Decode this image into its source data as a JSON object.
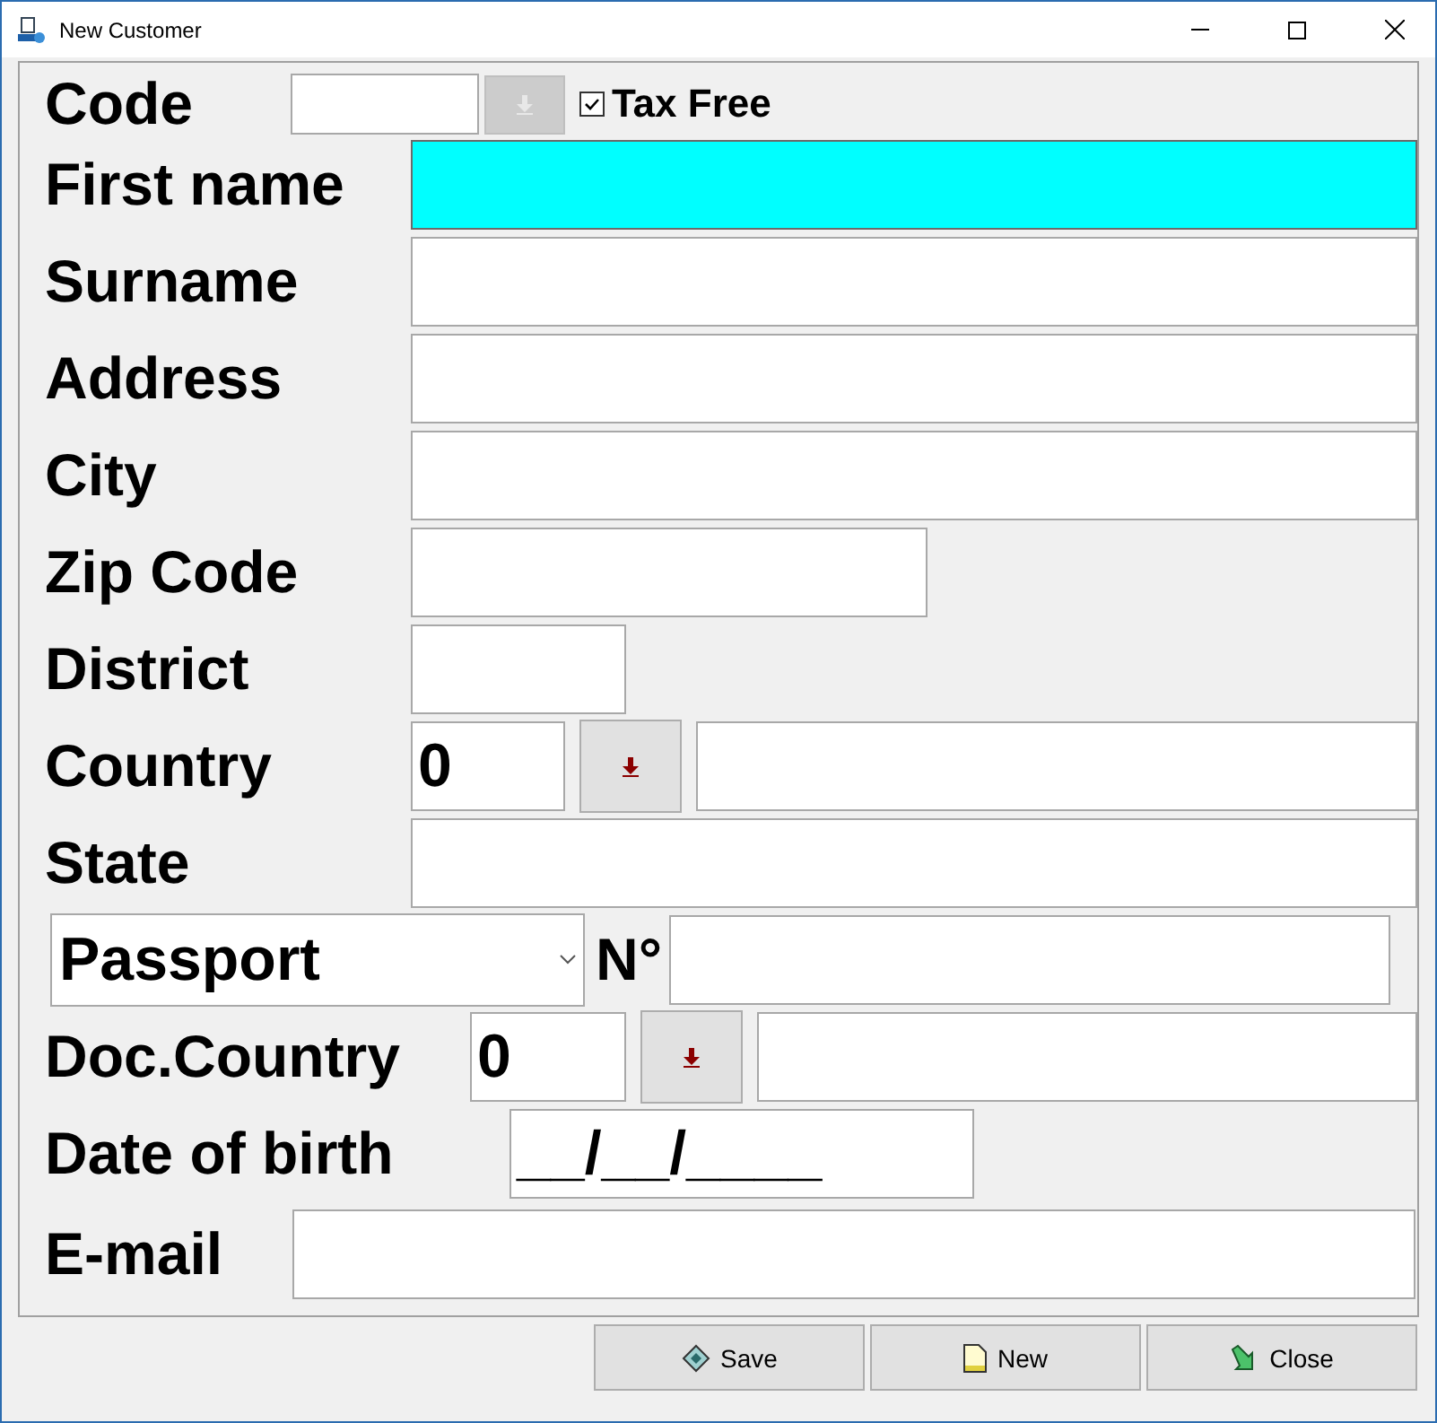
{
  "window": {
    "title": "New Customer"
  },
  "code": {
    "label": "Code",
    "lookup_disabled": true,
    "tax_free": {
      "label": "Tax Free",
      "checked": true
    }
  },
  "fields": [
    {
      "kind": "wide",
      "label": "First name",
      "focused": true
    },
    {
      "kind": "wide",
      "label": "Surname",
      "focused": false
    },
    {
      "kind": "wide",
      "label": "Address",
      "focused": false
    },
    {
      "kind": "wide",
      "label": "City",
      "focused": false
    },
    {
      "kind": "medium",
      "label": "Zip Code",
      "focused": false
    },
    {
      "kind": "small",
      "label": "District",
      "focused": false
    },
    {
      "kind": "lookup",
      "label": "Country",
      "value": "0",
      "focused": false
    },
    {
      "kind": "wide",
      "label": "State",
      "focused": false
    },
    {
      "kind": "document",
      "label": "Passport",
      "number_label": "N°",
      "focused": false
    },
    {
      "kind": "doc_lookup",
      "label": "Doc.Country",
      "value": "0",
      "focused": false
    },
    {
      "kind": "date",
      "label": "Date of birth",
      "value": "__/__/____",
      "focused": false
    },
    {
      "kind": "email",
      "label": "E-mail",
      "focused": false
    }
  ],
  "buttons": [
    {
      "kind": "save",
      "label": "Save"
    },
    {
      "kind": "new",
      "label": "New"
    },
    {
      "kind": "close",
      "label": "Close"
    }
  ]
}
